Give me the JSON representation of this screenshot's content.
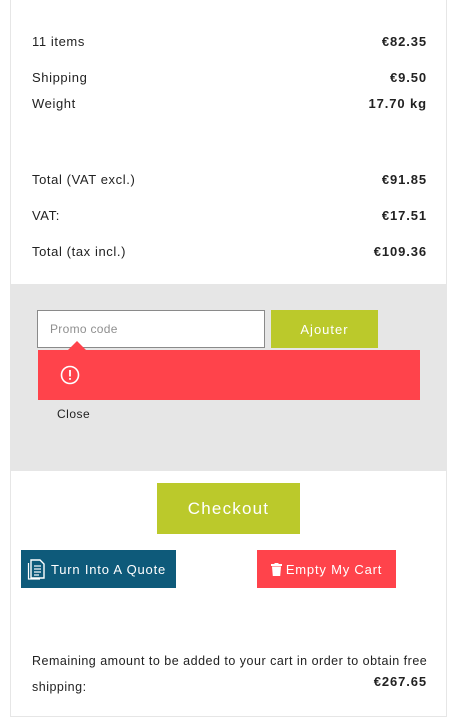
{
  "summary": {
    "items_label": "11 items",
    "items_value": "€82.35",
    "shipping_label": "Shipping",
    "shipping_value": "€9.50",
    "weight_label": "Weight",
    "weight_value": "17.70 kg",
    "total_excl_label": "Total (VAT excl.)",
    "total_excl_value": "€91.85",
    "vat_label": "VAT:",
    "vat_value": "€17.51",
    "total_incl_label": "Total (tax incl.)",
    "total_incl_value": "€109.36"
  },
  "promo": {
    "placeholder": "Promo code",
    "value": "",
    "submit_label": "Ajouter",
    "alert_icon": "error-circle-icon",
    "close_label": "Close"
  },
  "actions": {
    "checkout_label": "Checkout",
    "quote_label": "Turn Into A Quote",
    "quote_icon": "document-icon",
    "empty_label": "Empty My Cart",
    "empty_icon": "trash-icon"
  },
  "free_shipping": {
    "text": "Remaining amount to be added to your cart in order to obtain free shipping:",
    "amount": "€267.65"
  },
  "colors": {
    "accent_green": "#bbc92b",
    "alert_red": "#ff434b",
    "quote_blue": "#0e5a7a",
    "promo_bg": "#e6e6e6"
  }
}
